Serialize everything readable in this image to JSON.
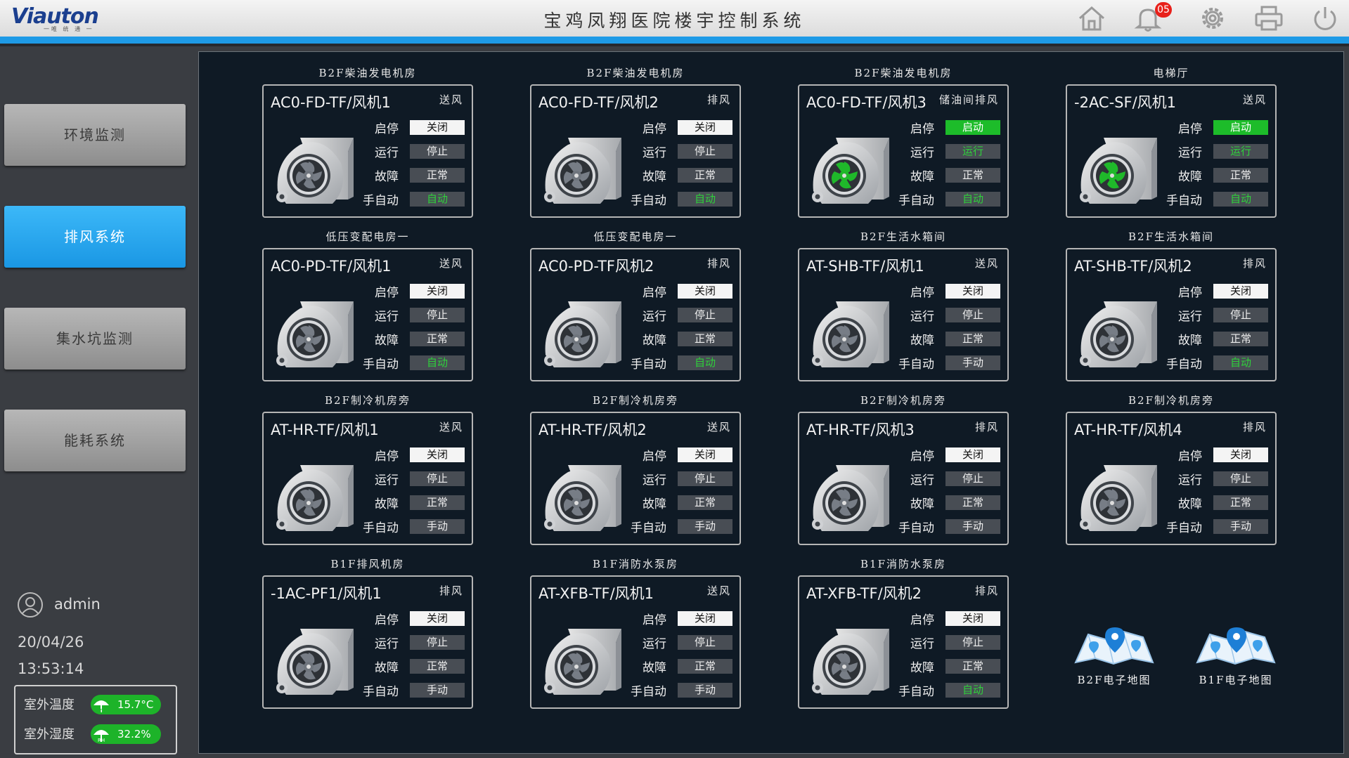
{
  "header": {
    "logo": "Viauton",
    "logo_sub": "一唯 统 通 一",
    "title": "宝鸡凤翔医院楼宇控制系统",
    "notification_count": "05",
    "icons": [
      "home-icon",
      "bell-icon",
      "gear-icon",
      "printer-icon",
      "power-icon"
    ]
  },
  "sidebar": {
    "items": [
      {
        "label": "环境监测",
        "active": false
      },
      {
        "label": "排风系统",
        "active": true
      },
      {
        "label": "集水坑监测",
        "active": false
      },
      {
        "label": "能耗系统",
        "active": false
      }
    ],
    "user": "admin",
    "date": "20/04/26",
    "time": "13:53:14",
    "weather": {
      "temp_label": "室外温度",
      "temp_value": "15.7°C",
      "humidity_label": "室外湿度",
      "humidity_value": "32.2%"
    }
  },
  "labels": {
    "start_stop": "启停",
    "run": "运行",
    "fault": "故障",
    "mode": "手自动"
  },
  "colors": {
    "accent": "#1e9ae6",
    "status_green": "#1dbc2a",
    "panel_bg": "#0f1a25"
  },
  "fans": [
    {
      "location": "B2F柴油发电机房",
      "name": "AC0-FD-TF/风机1",
      "type": "送风",
      "start_stop": "关闭",
      "run": "停止",
      "fault": "正常",
      "mode": "自动",
      "active": false
    },
    {
      "location": "B2F柴油发电机房",
      "name": "AC0-FD-TF/风机2",
      "type": "排风",
      "start_stop": "关闭",
      "run": "停止",
      "fault": "正常",
      "mode": "自动",
      "active": false
    },
    {
      "location": "B2F柴油发电机房",
      "name": "AC0-FD-TF/风机3",
      "type": "储油间排风",
      "start_stop": "启动",
      "run": "运行",
      "fault": "正常",
      "mode": "自动",
      "active": true
    },
    {
      "location": "电梯厅",
      "name": "-2AC-SF/风机1",
      "type": "送风",
      "start_stop": "启动",
      "run": "运行",
      "fault": "正常",
      "mode": "自动",
      "active": true
    },
    {
      "location": "低压变配电房一",
      "name": "AC0-PD-TF/风机1",
      "type": "送风",
      "start_stop": "关闭",
      "run": "停止",
      "fault": "正常",
      "mode": "自动",
      "active": false
    },
    {
      "location": "低压变配电房一",
      "name": "AC0-PD-TF风机2",
      "type": "排风",
      "start_stop": "关闭",
      "run": "停止",
      "fault": "正常",
      "mode": "自动",
      "active": false
    },
    {
      "location": "B2F生活水箱间",
      "name": "AT-SHB-TF/风机1",
      "type": "送风",
      "start_stop": "关闭",
      "run": "停止",
      "fault": "正常",
      "mode": "手动",
      "active": false
    },
    {
      "location": "B2F生活水箱间",
      "name": "AT-SHB-TF/风机2",
      "type": "排风",
      "start_stop": "关闭",
      "run": "停止",
      "fault": "正常",
      "mode": "自动",
      "active": false
    },
    {
      "location": "B2F制冷机房旁",
      "name": "AT-HR-TF/风机1",
      "type": "送风",
      "start_stop": "关闭",
      "run": "停止",
      "fault": "正常",
      "mode": "手动",
      "active": false
    },
    {
      "location": "B2F制冷机房旁",
      "name": "AT-HR-TF/风机2",
      "type": "送风",
      "start_stop": "关闭",
      "run": "停止",
      "fault": "正常",
      "mode": "手动",
      "active": false
    },
    {
      "location": "B2F制冷机房旁",
      "name": "AT-HR-TF/风机3",
      "type": "排风",
      "start_stop": "关闭",
      "run": "停止",
      "fault": "正常",
      "mode": "手动",
      "active": false
    },
    {
      "location": "B2F制冷机房旁",
      "name": "AT-HR-TF/风机4",
      "type": "排风",
      "start_stop": "关闭",
      "run": "停止",
      "fault": "正常",
      "mode": "手动",
      "active": false
    },
    {
      "location": "B1F排风机房",
      "name": "-1AC-PF1/风机1",
      "type": "排风",
      "start_stop": "关闭",
      "run": "停止",
      "fault": "正常",
      "mode": "手动",
      "active": false
    },
    {
      "location": "B1F消防水泵房",
      "name": "AT-XFB-TF/风机1",
      "type": "送风",
      "start_stop": "关闭",
      "run": "停止",
      "fault": "正常",
      "mode": "手动",
      "active": false
    },
    {
      "location": "B1F消防水泵房",
      "name": "AT-XFB-TF/风机2",
      "type": "排风",
      "start_stop": "关闭",
      "run": "停止",
      "fault": "正常",
      "mode": "自动",
      "active": false
    }
  ],
  "maps": [
    {
      "label": "B2F电子地图"
    },
    {
      "label": "B1F电子地图"
    }
  ]
}
